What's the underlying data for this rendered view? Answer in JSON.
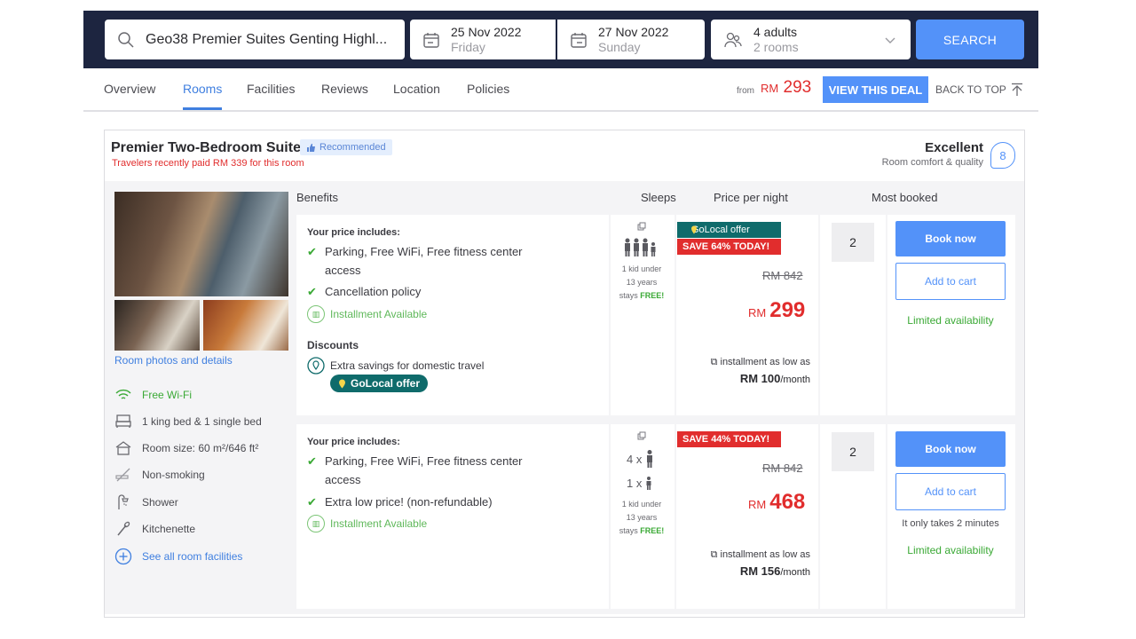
{
  "search": {
    "hotel": "Geo38 Premier Suites Genting Highl...",
    "checkin_date": "25 Nov 2022",
    "checkin_day": "Friday",
    "checkout_date": "27 Nov 2022",
    "checkout_day": "Sunday",
    "guests": "4 adults",
    "rooms": "2 rooms",
    "button": "SEARCH"
  },
  "tabs": [
    "Overview",
    "Rooms",
    "Facilities",
    "Reviews",
    "Location",
    "Policies"
  ],
  "deal": {
    "from_label": "from",
    "currency": "RM",
    "price": "293",
    "button": "VIEW THIS DEAL",
    "back_to_top": "BACK TO TOP"
  },
  "room": {
    "title": "Premier Two-Bedroom Suite",
    "badge": "Recommended",
    "paid_note": "Travelers recently paid RM 339 for this room",
    "rating_label": "Excellent",
    "rating_sub": "Room comfort & quality",
    "score": "8",
    "photo_link": "Room photos and details",
    "facilities": [
      "Free Wi-Fi",
      "1 king bed & 1 single bed",
      "Room size: 60 m²/646 ft²",
      "Non-smoking",
      "Shower",
      "Kitchenette",
      "See all room facilities"
    ]
  },
  "headers": {
    "benefits": "Benefits",
    "sleeps": "Sleeps",
    "price": "Price per night",
    "most_booked": "Most booked"
  },
  "offers": [
    {
      "includes_title": "Your price includes:",
      "benefit1_a": "Parking, Free WiFi, Free fitness center",
      "benefit1_b": "access",
      "benefit2": "Cancellation policy",
      "installment": "Installment Available",
      "discounts_title": "Discounts",
      "discount_text": "Extra savings for domestic travel",
      "golocal": "GoLocal offer",
      "kid_line1": "1 kid under",
      "kid_line2": "13 years",
      "kid_line3": "stays",
      "kid_free": "FREE!",
      "golocal_tag": "GoLocal offer",
      "save_tag": "SAVE 64% TODAY!",
      "old_price": "RM 842",
      "currency": "RM",
      "price": "299",
      "inst_text": "installment as low as",
      "inst_amount": "RM 100",
      "inst_unit": "/month",
      "qty": "2",
      "book": "Book now",
      "cart": "Add to cart",
      "limited": "Limited availability"
    },
    {
      "includes_title": "Your price includes:",
      "benefit1_a": "Parking, Free WiFi, Free fitness center",
      "benefit1_b": "access",
      "benefit2": "Extra low price! (non-refundable)",
      "installment": "Installment Available",
      "adults": "4 x",
      "kids": "1 x",
      "kid_line1": "1 kid under",
      "kid_line2": "13 years",
      "kid_line3": "stays",
      "kid_free": "FREE!",
      "save_tag": "SAVE 44% TODAY!",
      "old_price": "RM 842",
      "currency": "RM",
      "price": "468",
      "inst_text": "installment as low as",
      "inst_amount": "RM 156",
      "inst_unit": "/month",
      "qty": "2",
      "book": "Book now",
      "cart": "Add to cart",
      "takes": "It only takes 2 minutes",
      "limited": "Limited availability"
    }
  ],
  "colors": {
    "navy": "#1d2540",
    "accent": "#5392f9",
    "red": "#e12d2d",
    "green": "#3aa935",
    "teal": "#0f6b6b"
  }
}
